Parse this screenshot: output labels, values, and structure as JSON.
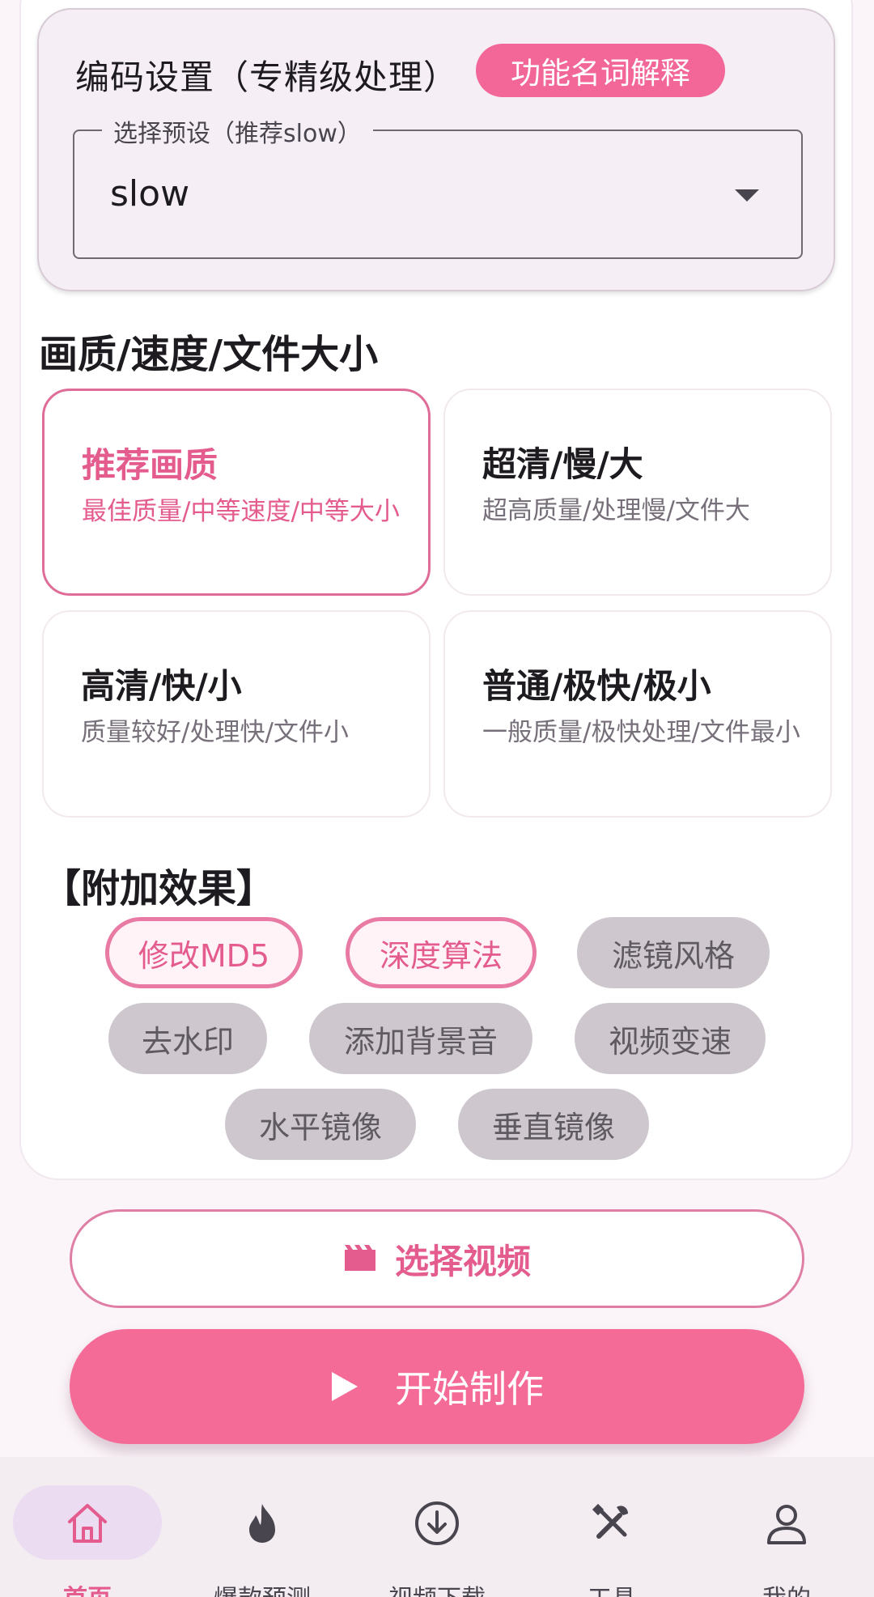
{
  "encode": {
    "title": "编码设置（专精级处理）",
    "help_chip": "功能名词解释",
    "select_label": "选择预设（推荐slow）",
    "select_value": "slow"
  },
  "quality": {
    "section_title": "画质/速度/文件大小",
    "options": [
      {
        "title": "推荐画质",
        "desc": "最佳质量/中等速度/中等大小",
        "selected": true
      },
      {
        "title": "超清/慢/大",
        "desc": "超高质量/处理慢/文件大",
        "selected": false
      },
      {
        "title": "高清/快/小",
        "desc": "质量较好/处理快/文件小",
        "selected": false
      },
      {
        "title": "普通/极快/极小",
        "desc": "一般质量/极快处理/文件最小",
        "selected": false
      }
    ]
  },
  "effects": {
    "title": "【附加效果】",
    "chips": [
      {
        "label": "修改MD5",
        "active": true
      },
      {
        "label": "深度算法",
        "active": true
      },
      {
        "label": "滤镜风格",
        "active": false
      },
      {
        "label": "去水印",
        "active": false
      },
      {
        "label": "添加背景音",
        "active": false
      },
      {
        "label": "视频变速",
        "active": false
      },
      {
        "label": "水平镜像",
        "active": false
      },
      {
        "label": "垂直镜像",
        "active": false
      }
    ]
  },
  "actions": {
    "select_video": "选择视频",
    "start": "开始制作"
  },
  "nav": {
    "items": [
      {
        "label": "首页",
        "icon": "home-icon",
        "active": true
      },
      {
        "label": "爆款预测",
        "icon": "fire-icon",
        "active": false
      },
      {
        "label": "视频下载",
        "icon": "download-icon",
        "active": false
      },
      {
        "label": "工具",
        "icon": "tools-icon",
        "active": false
      },
      {
        "label": "我的",
        "icon": "user-icon",
        "active": false
      }
    ]
  },
  "colors": {
    "accent": "#f56b97",
    "accent_text": "#e45b8e",
    "chip_inactive": "#cec8ce",
    "nav_active_pill": "#ecdcf2"
  }
}
